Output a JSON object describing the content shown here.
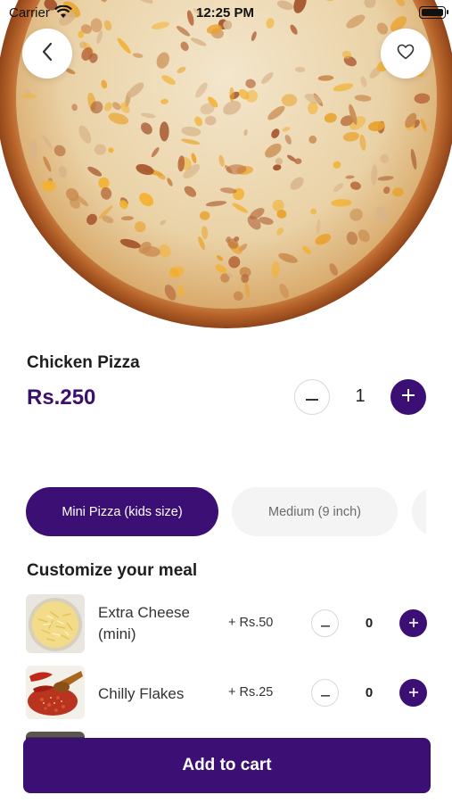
{
  "status_bar": {
    "carrier": "Carrier",
    "time": "12:25 PM"
  },
  "hero": {
    "image": "chicken-pizza-photo",
    "back_icon": "chevron-left-icon",
    "favorite_icon": "heart-outline-icon"
  },
  "product": {
    "name": "Chicken Pizza",
    "price": "Rs.250",
    "quantity": "1"
  },
  "sizes": [
    {
      "label": "Mini Pizza (kids size)",
      "selected": true
    },
    {
      "label": "Medium (9 inch)",
      "selected": false
    },
    {
      "label": "",
      "selected": false
    }
  ],
  "customize": {
    "title": "Customize your meal",
    "items": [
      {
        "name_line1": "Extra Cheese",
        "name_line2": "(mini)",
        "price": "+ Rs.50",
        "quantity": "0",
        "image": "grated-cheese-photo"
      },
      {
        "name_line1": "Chilly Flakes",
        "name_line2": "",
        "price": "+ Rs.25",
        "quantity": "0",
        "image": "chilli-flakes-photo"
      }
    ]
  },
  "cart": {
    "button_label": "Add to cart"
  },
  "colors": {
    "accent": "#3b0f73",
    "price": "#3b116e",
    "pill_inactive": "#f4f4f4"
  }
}
